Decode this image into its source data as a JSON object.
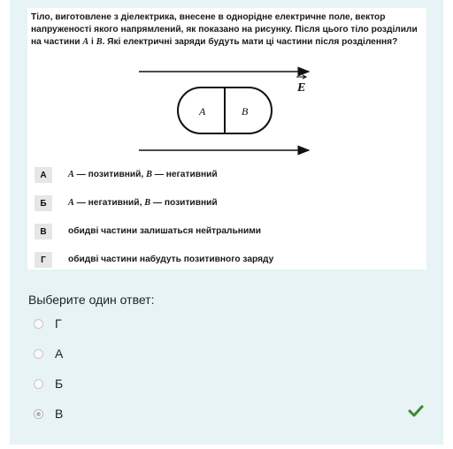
{
  "question": {
    "line1": "Тіло, виготовлене з діелектрика, внесене в однорідне електричне поле, вектор",
    "line2": "напруженості якого напрямлений, як показано на рисунку. Після цього тіло розділили",
    "line3a": "на частини ",
    "partA": "A",
    "line3b": " і ",
    "partB": "B",
    "line3c": ". Які електричні заряди будуть мати ці частини після розділення?"
  },
  "figure": {
    "field_label": "E",
    "label_a": "A",
    "label_b": "B"
  },
  "options": [
    {
      "letter": "А",
      "pre": "",
      "a": "A",
      "mid": " — позитивний, ",
      "b": "B",
      "post": " — негативний"
    },
    {
      "letter": "Б",
      "pre": "",
      "a": "A",
      "mid": " — негативний, ",
      "b": "B",
      "post": " — позитивний"
    },
    {
      "letter": "В",
      "text": "обидві частини залишаться нейтральними"
    },
    {
      "letter": "Г",
      "text": "обидві частини набудуть позитивного заряду"
    }
  ],
  "prompt": "Выберите один ответ:",
  "answers": [
    {
      "label": "Г",
      "selected": false
    },
    {
      "label": "А",
      "selected": false
    },
    {
      "label": "Б",
      "selected": false
    },
    {
      "label": "В",
      "selected": true
    }
  ],
  "correct_icon": "checkmark-icon",
  "colors": {
    "panel": "#e7f3f5",
    "check": "#3d8a2b"
  }
}
